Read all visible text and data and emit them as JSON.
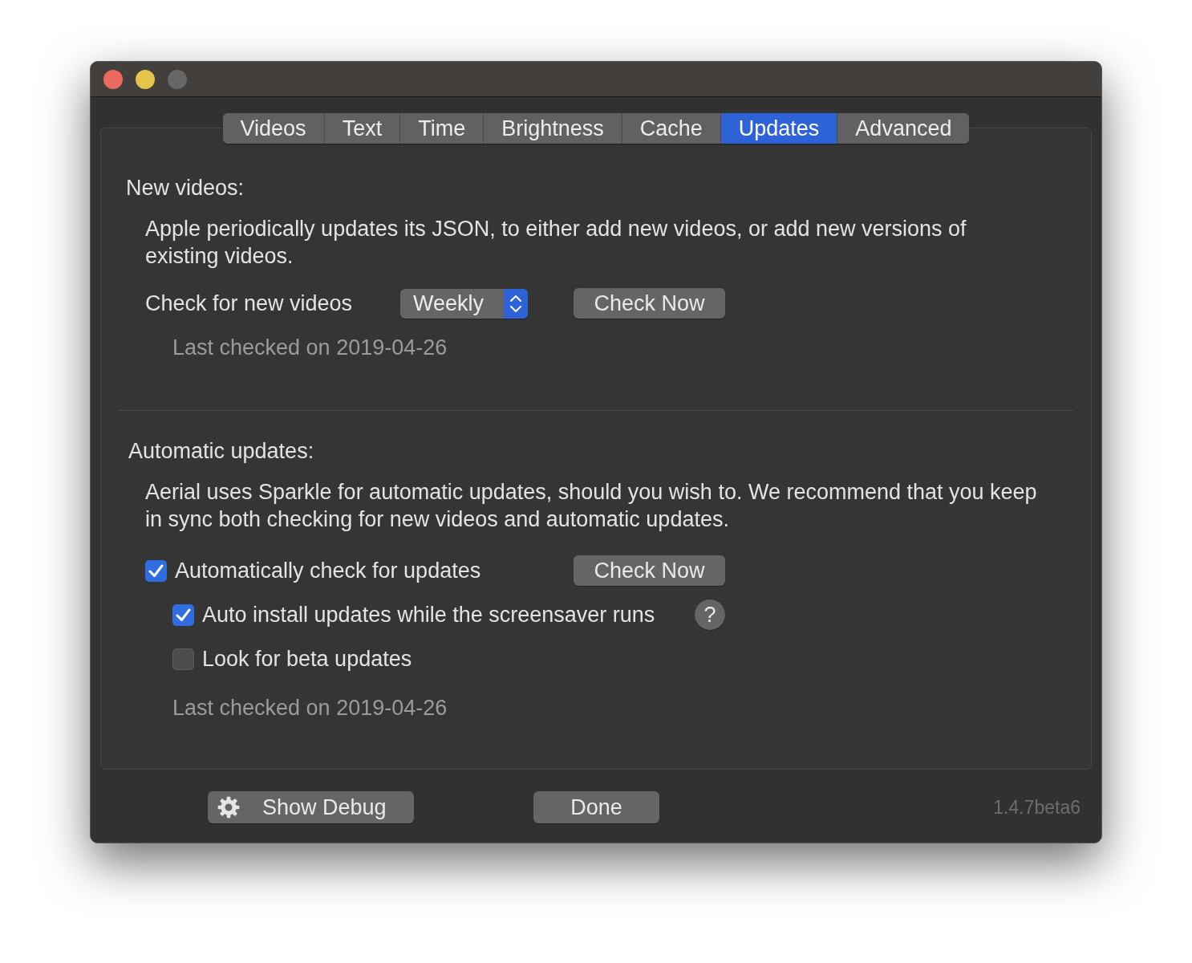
{
  "window": {
    "controls": [
      {
        "kind": "close",
        "disabled": false
      },
      {
        "kind": "minimize",
        "disabled": false
      },
      {
        "kind": "zoom",
        "disabled": true
      }
    ]
  },
  "tabs": [
    {
      "label": "Videos",
      "selected": false
    },
    {
      "label": "Text",
      "selected": false
    },
    {
      "label": "Time",
      "selected": false
    },
    {
      "label": "Brightness",
      "selected": false
    },
    {
      "label": "Cache",
      "selected": false
    },
    {
      "label": "Updates",
      "selected": true
    },
    {
      "label": "Advanced",
      "selected": false
    }
  ],
  "new_videos": {
    "heading": "New videos:",
    "description": "Apple periodically updates its JSON, to either add new videos, or add new versions of existing videos.",
    "check_label": "Check for new videos",
    "frequency": {
      "value": "Weekly"
    },
    "check_button": "Check Now",
    "last_checked": "Last checked on 2019-04-26"
  },
  "automatic_updates": {
    "heading": "Automatic updates:",
    "description": "Aerial uses Sparkle for automatic updates, should you wish to. We recommend that you keep in sync both checking for new videos and automatic updates.",
    "options": [
      {
        "label": "Automatically check for updates",
        "checked": true,
        "button": "Check Now",
        "children": [
          {
            "label": "Auto install updates while the screensaver runs",
            "checked": true,
            "help_button": "?"
          },
          {
            "label": "Look for beta updates",
            "checked": false
          }
        ]
      }
    ],
    "last_checked": "Last checked on 2019-04-26"
  },
  "footer": {
    "debug_button": "Show Debug",
    "done_button": "Done",
    "version": "1.4.7beta6"
  }
}
